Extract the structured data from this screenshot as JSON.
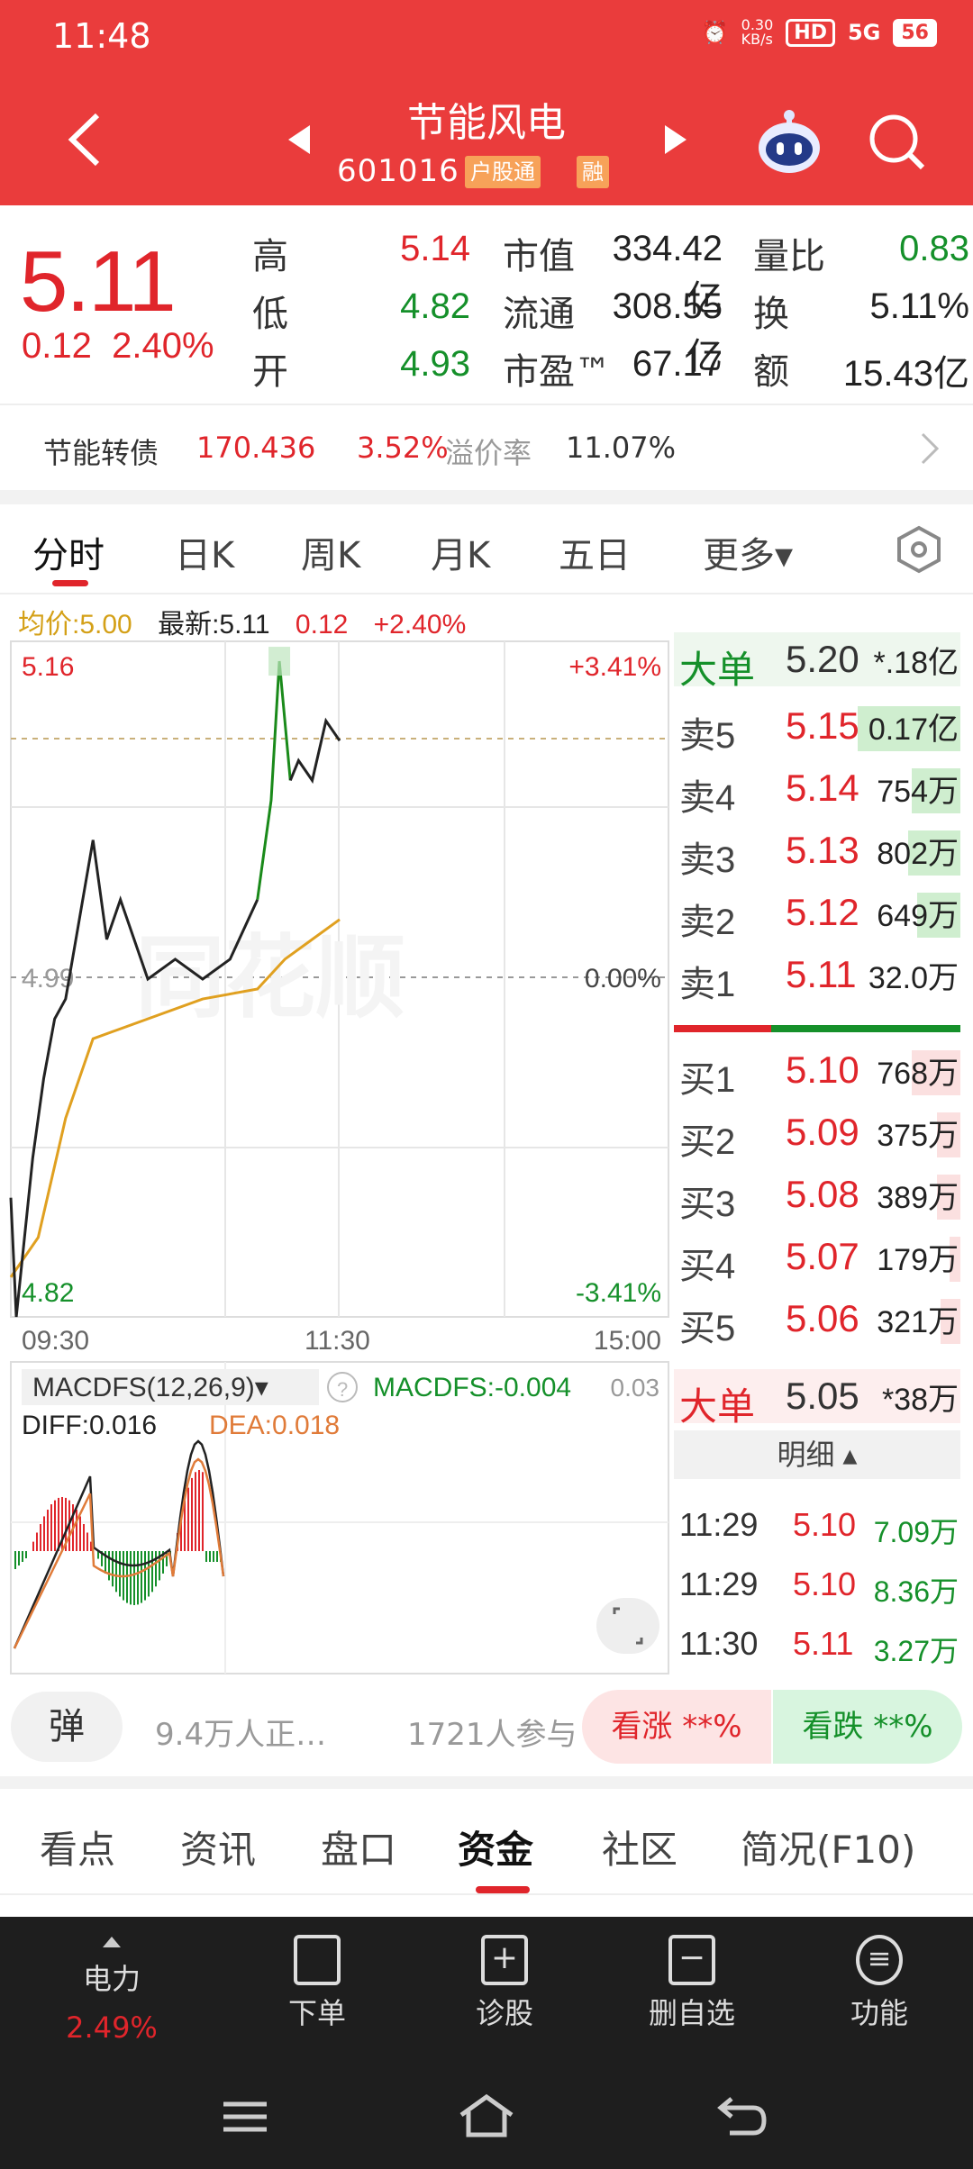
{
  "status": {
    "time": "11:48",
    "net_speed": "0.30\nKB/s",
    "hd": "HD",
    "signal": "5G",
    "battery": "56"
  },
  "nav": {
    "title": "节能风电",
    "code": "601016",
    "tag1": "户股通",
    "tag2": "融"
  },
  "quote": {
    "price": "5.11",
    "change": "0.12",
    "change_pct": "2.40%",
    "labels": {
      "high": "高",
      "low": "低",
      "open": "开",
      "mcap": "市值",
      "float": "流通",
      "pe": "市盈™",
      "vr": "量比",
      "turn": "换",
      "amount": "额"
    },
    "high": "5.14",
    "low": "4.82",
    "open": "4.93",
    "mcap": "334.42亿",
    "float": "308.55亿",
    "pe": "67.17",
    "vr": "0.83",
    "turn": "5.11%",
    "amount": "15.43亿"
  },
  "bond": {
    "name": "节能转债",
    "price": "170.436",
    "pct": "3.52%",
    "premium_label": "溢价率",
    "premium": "11.07%"
  },
  "period_tabs": [
    "分时",
    "日K",
    "周K",
    "月K",
    "五日",
    "更多▾"
  ],
  "legend": {
    "avg": "均价:5.00",
    "latest": "最新:5.11",
    "chg": "0.12",
    "pct": "+2.40%"
  },
  "chart_labels": {
    "high": "5.16",
    "high_pct": "+3.41%",
    "mid": "4.99",
    "mid_pct": "0.00%",
    "low": "4.82",
    "low_pct": "-3.41%",
    "t0": "09:30",
    "t1": "11:30",
    "t2": "15:00",
    "macd_title": "MACDFS(12,26,9)▾",
    "macd_value": "MACDFS:-0.004",
    "macd_right": "0.03",
    "diff": "DIFF:0.016",
    "dea": "DEA:0.018"
  },
  "chart_data": {
    "type": "line",
    "title": "",
    "xlabel": "",
    "ylabel": "",
    "ylim": [
      4.82,
      5.16
    ],
    "series": [
      {
        "x": [
          "09:30",
          "09:32",
          "09:35",
          "09:38",
          "09:42",
          "09:46",
          "09:50",
          "09:55",
          "10:00",
          "10:05",
          "10:10",
          "10:20",
          "10:30",
          "10:40",
          "10:50",
          "11:00",
          "11:05",
          "11:08",
          "11:12",
          "11:15",
          "11:20",
          "11:25",
          "11:30"
        ],
        "values": [
          4.88,
          4.82,
          4.86,
          4.9,
          4.94,
          4.97,
          4.98,
          5.02,
          5.06,
          5.01,
          5.03,
          4.99,
          5.0,
          4.99,
          5.0,
          5.03,
          5.08,
          5.15,
          5.09,
          5.1,
          5.09,
          5.12,
          5.11
        ]
      },
      {
        "x": [
          "09:30",
          "09:40",
          "09:50",
          "10:00",
          "10:20",
          "10:40",
          "11:00",
          "11:10",
          "11:20",
          "11:30"
        ],
        "values": [
          4.84,
          4.86,
          4.92,
          4.96,
          4.97,
          4.98,
          4.985,
          5.0,
          5.01,
          5.02
        ]
      }
    ]
  },
  "book": {
    "big_sell_label": "大单",
    "big_sell_price": "5.20",
    "big_sell_vol": "*.18亿",
    "asks": [
      {
        "label": "卖5",
        "price": "5.15",
        "vol": "0.17亿",
        "bar": 0.95
      },
      {
        "label": "卖4",
        "price": "5.14",
        "vol": "754万",
        "bar": 0.45
      },
      {
        "label": "卖3",
        "price": "5.13",
        "vol": "802万",
        "bar": 0.48
      },
      {
        "label": "卖2",
        "price": "5.12",
        "vol": "649万",
        "bar": 0.4
      },
      {
        "label": "卖1",
        "price": "5.11",
        "vol": "32.0万",
        "bar": 0.0
      }
    ],
    "bids": [
      {
        "label": "买1",
        "price": "5.10",
        "vol": "768万",
        "bar": 0.45
      },
      {
        "label": "买2",
        "price": "5.09",
        "vol": "375万",
        "bar": 0.22
      },
      {
        "label": "买3",
        "price": "5.08",
        "vol": "389万",
        "bar": 0.22
      },
      {
        "label": "买4",
        "price": "5.07",
        "vol": "179万",
        "bar": 0.1
      },
      {
        "label": "买5",
        "price": "5.06",
        "vol": "321万",
        "bar": 0.18
      }
    ],
    "big_buy_label": "大单",
    "big_buy_price": "5.05",
    "big_buy_vol": "*38万",
    "detail_label": "明细 ▴",
    "ticks": [
      {
        "time": "11:29",
        "price": "5.10",
        "vol": "7.09万"
      },
      {
        "time": "11:29",
        "price": "5.10",
        "vol": "8.36万"
      },
      {
        "time": "11:30",
        "price": "5.11",
        "vol": "3.27万"
      }
    ]
  },
  "vote": {
    "danmu": "弹",
    "viewers": "9.4万人正…",
    "participants": "1721人参与",
    "bull": "看涨 **%",
    "bear": "看跌 **%"
  },
  "bottom_tabs": [
    "看点",
    "资讯",
    "盘口",
    "资金",
    "社区",
    "简况(F10)"
  ],
  "toolbar": {
    "sector": "电力",
    "sector_pct": "2.49%",
    "order": "下单",
    "diagnose": "诊股",
    "remove": "删自选",
    "func": "功能"
  }
}
